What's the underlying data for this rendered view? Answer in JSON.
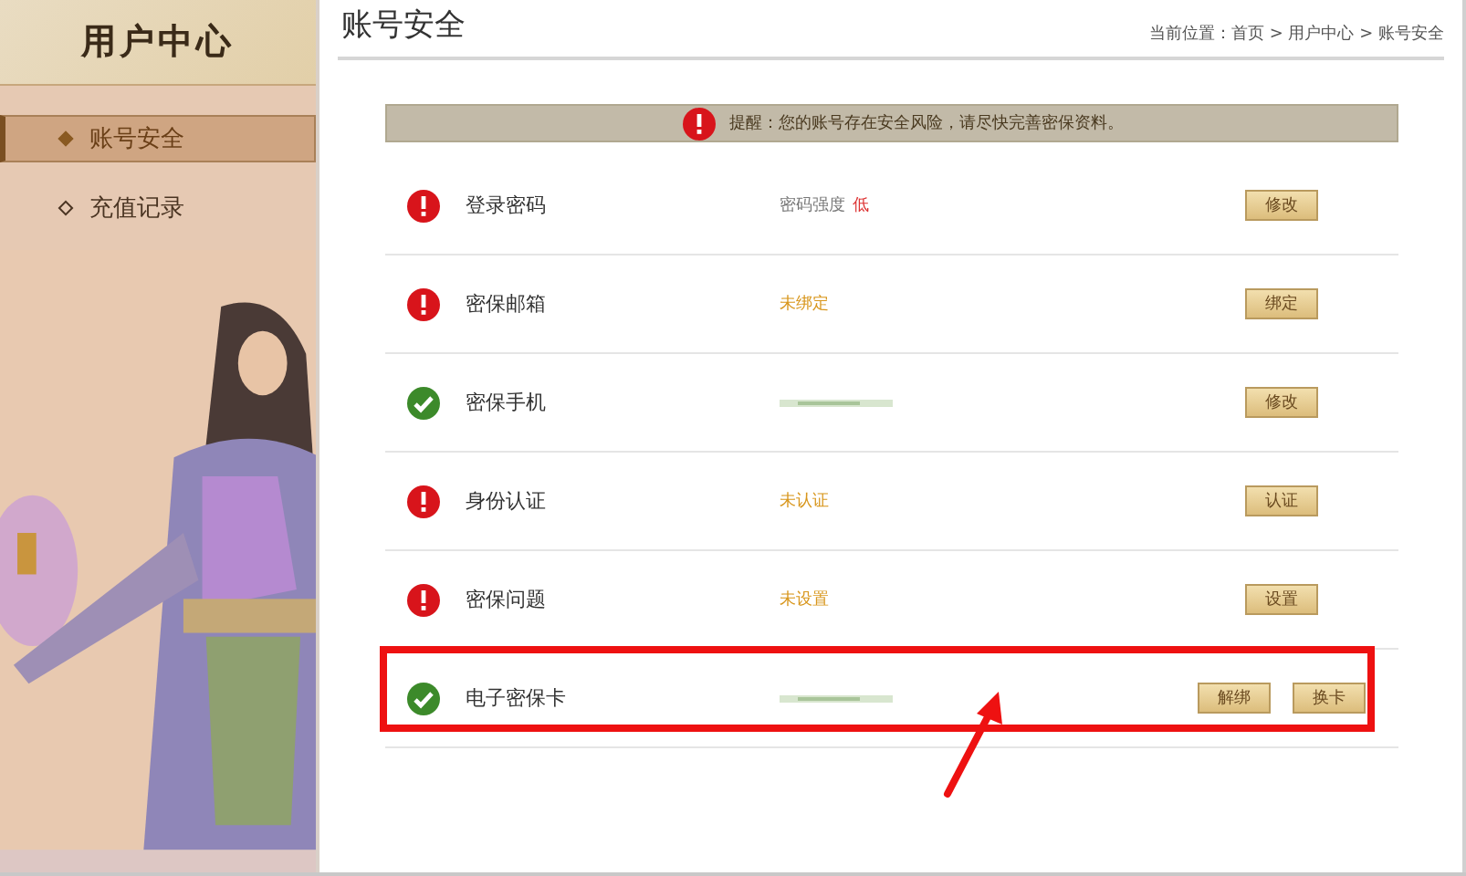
{
  "sidebar": {
    "title": "用户中心",
    "items": [
      {
        "label": "账号安全",
        "selected": true
      },
      {
        "label": "充值记录",
        "selected": false
      }
    ]
  },
  "header": {
    "title": "账号安全",
    "breadcrumb": "当前位置：首页 > 用户中心 > 账号安全"
  },
  "alert": {
    "text": "提醒：您的账号存在安全风险，请尽快完善密保资料。"
  },
  "rows": [
    {
      "label": "登录密码",
      "secure": false,
      "value": {
        "kind": "strength",
        "text": "密码强度",
        "level_text": "低"
      },
      "buttons": [
        "修改"
      ],
      "highlighted": false
    },
    {
      "label": "密保邮箱",
      "secure": false,
      "value": {
        "kind": "pending",
        "text": "未绑定"
      },
      "buttons": [
        "绑定"
      ],
      "highlighted": false
    },
    {
      "label": "密保手机",
      "secure": true,
      "value": {
        "kind": "masked"
      },
      "buttons": [
        "修改"
      ],
      "highlighted": false
    },
    {
      "label": "身份认证",
      "secure": false,
      "value": {
        "kind": "pending",
        "text": "未认证"
      },
      "buttons": [
        "认证"
      ],
      "highlighted": false
    },
    {
      "label": "密保问题",
      "secure": false,
      "value": {
        "kind": "pending",
        "text": "未设置"
      },
      "buttons": [
        "设置"
      ],
      "highlighted": false
    },
    {
      "label": "电子密保卡",
      "secure": true,
      "value": {
        "kind": "masked"
      },
      "buttons": [
        "解绑",
        "换卡"
      ],
      "highlighted": true
    }
  ],
  "annotation": {
    "kind": "arrow"
  }
}
